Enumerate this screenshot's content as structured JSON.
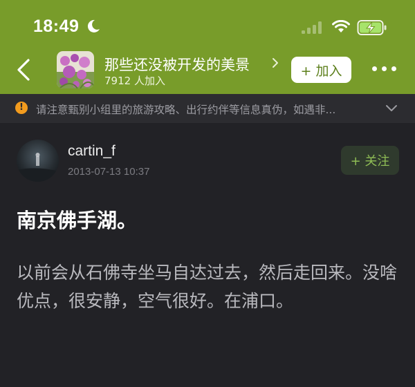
{
  "status_bar": {
    "time": "18:49",
    "icons": [
      "moon-icon",
      "signal-icon",
      "wifi-icon",
      "battery-charging-icon"
    ]
  },
  "group": {
    "name": "那些还没被开发的美景",
    "member_count": "7912 人加入",
    "join_label": "+ 加入",
    "avatar": "flower-field-thumbnail"
  },
  "notice": {
    "text": "请注意甄别小组里的旅游攻略、出行约伴等信息真伪，如遇非..."
  },
  "post": {
    "author": "cartin_f",
    "time": "2013-07-13 10:37",
    "follow_label": "+ 关注",
    "title": "南京佛手湖。",
    "body": "以前会从石佛寺坐马自达过去，然后走回来。没啥优点，很安静，空气很好。在浦口。"
  },
  "colors": {
    "header_green": "#789c2a",
    "background": "#222226",
    "follow_green": "#8fbd55",
    "notice_orange": "#f29b1e"
  }
}
